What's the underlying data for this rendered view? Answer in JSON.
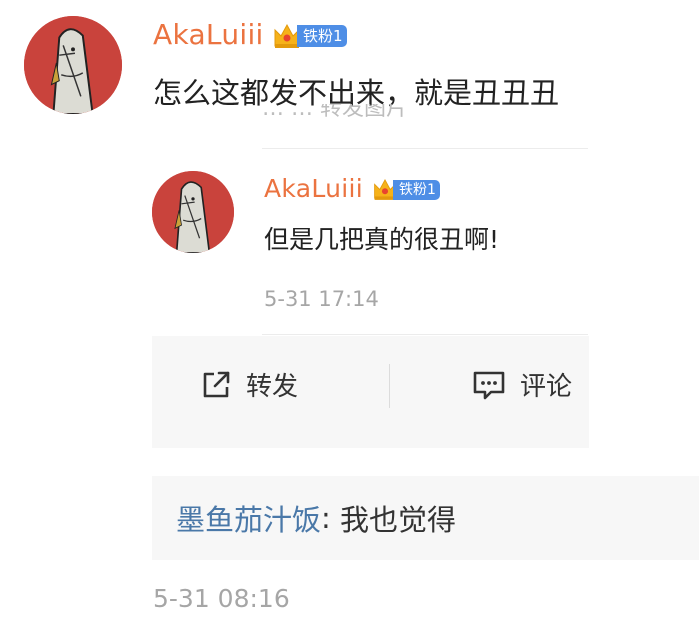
{
  "post": {
    "username": "AkaLuiii",
    "badge_label": "铁粉1",
    "message": "怎么这都发不出来，就是丑丑丑",
    "faded_text": "…  …  转发图片"
  },
  "reply": {
    "username": "AkaLuiii",
    "badge_label": "铁粉1",
    "message": "但是几把真的很丑啊!",
    "timestamp": "5-31 17:14"
  },
  "actions": {
    "repost_label": "转发",
    "comment_label": "评论"
  },
  "comment": {
    "user": "墨鱼茄汁饭",
    "separator": ": ",
    "text": "我也觉得",
    "timestamp": "5-31 08:16"
  },
  "icons": {
    "avatar": "fish-avatar-icon",
    "crown": "crown-icon",
    "repost": "share-external-icon",
    "comment": "comment-bubble-icon"
  },
  "colors": {
    "username": "#eb7340",
    "badge": "#4e8ee6",
    "crown": "#f6b21a",
    "comment_user": "#4a78a8",
    "avatar_bg": "#c9433c",
    "panel_bg": "#f7f7f7",
    "timestamp": "#a6a6a6"
  }
}
